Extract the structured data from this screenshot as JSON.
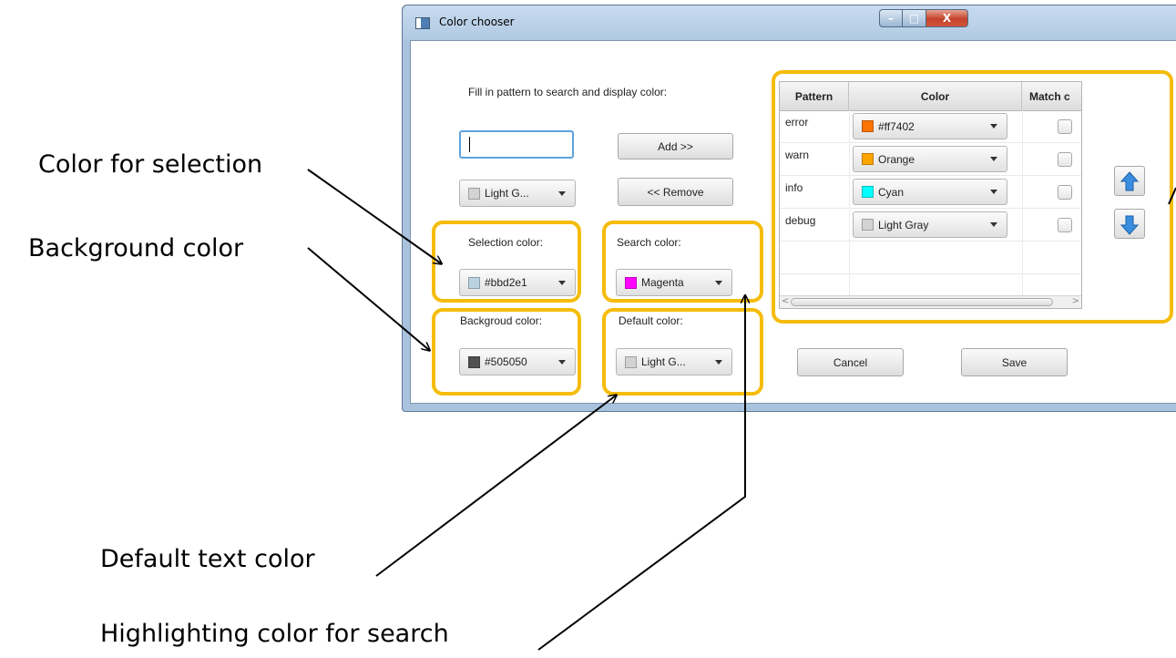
{
  "window": {
    "title": "Color chooser",
    "buttons": {
      "minimize": "–",
      "maximize": "□",
      "close": "X"
    }
  },
  "form": {
    "instruction": "Fill in pattern to search and display color:",
    "pattern_input": {
      "value": "",
      "placeholder": ""
    },
    "new_color": {
      "value": "Light G...",
      "swatch": "#d3d3d3"
    },
    "add_label": "Add >>",
    "remove_label": "<< Remove",
    "selection": {
      "label": "Selection color:",
      "value": "#bbd2e1",
      "swatch": "#bbd2e1"
    },
    "search": {
      "label": "Search color:",
      "value": "Magenta",
      "swatch": "#ff00ff"
    },
    "background": {
      "label": "Backgroud color:",
      "value": "#505050",
      "swatch": "#505050"
    },
    "default": {
      "label": "Default color:",
      "value": "Light G...",
      "swatch": "#d3d3d3"
    },
    "cancel_label": "Cancel",
    "save_label": "Save"
  },
  "table": {
    "headers": [
      "Pattern",
      "Color",
      "Match c"
    ],
    "rows": [
      {
        "pattern": "error",
        "color": "#ff7402",
        "swatch": "#ff7402",
        "match": false
      },
      {
        "pattern": "warn",
        "color": "Orange",
        "swatch": "#ffa500",
        "match": false
      },
      {
        "pattern": "info",
        "color": "Cyan",
        "swatch": "#00ffff",
        "match": false
      },
      {
        "pattern": "debug",
        "color": "Light Gray",
        "swatch": "#d3d3d3",
        "match": false
      }
    ]
  },
  "move_buttons": {
    "up_icon": "arrow-up-icon",
    "down_icon": "arrow-down-icon"
  },
  "highlight_color": "#f5bc0c",
  "annotations": {
    "selection": "Color for selection",
    "background": "Background color",
    "default_text": "Default text color",
    "search_highlight": "Highlighting color for search"
  }
}
